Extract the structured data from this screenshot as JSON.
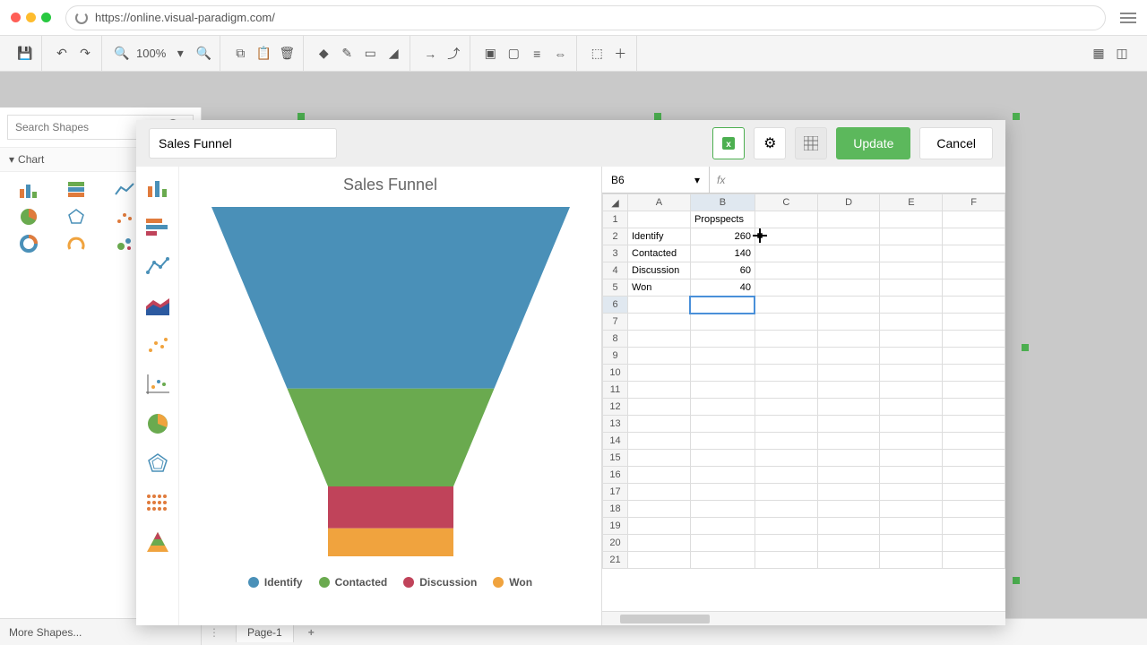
{
  "browser": {
    "url": "https://online.visual-paradigm.com/"
  },
  "toolbar": {
    "zoom": "100%"
  },
  "sidebar": {
    "search_placeholder": "Search Shapes",
    "section": "Chart",
    "more_shapes": "More Shapes..."
  },
  "page_tab": "Page-1",
  "editor": {
    "title": "Sales Funnel",
    "update": "Update",
    "cancel": "Cancel",
    "cell_ref": "B6",
    "fx_value": ""
  },
  "chart_data": {
    "type": "funnel",
    "title": "Sales Funnel",
    "series_name": "Propspects",
    "categories": [
      "Identify",
      "Contacted",
      "Discussion",
      "Won"
    ],
    "values": [
      260,
      140,
      60,
      40
    ],
    "colors": [
      "#4a90b8",
      "#6aaa4f",
      "#c0435a",
      "#f0a33e"
    ]
  },
  "sheet": {
    "columns": [
      "A",
      "B",
      "C",
      "D",
      "E",
      "F"
    ],
    "rows": 21,
    "cells": {
      "B1": "Propspects",
      "A2": "Identify",
      "B2": "260",
      "A3": "Contacted",
      "B3": "140",
      "A4": "Discussion",
      "B4": "60",
      "A5": "Won",
      "B5": "40"
    },
    "selected": "B6"
  }
}
